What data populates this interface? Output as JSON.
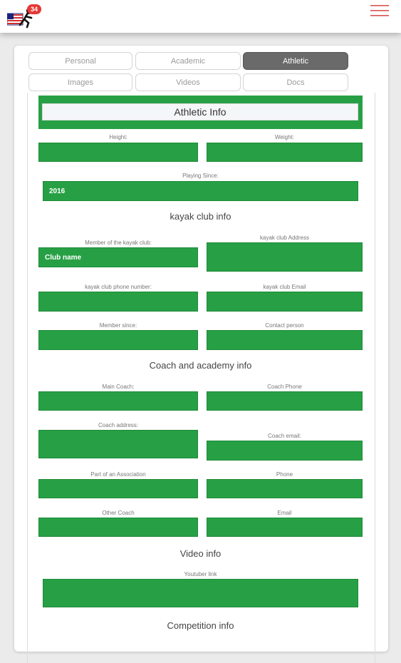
{
  "app": {
    "badge_count": "34",
    "accent_color": "#27a045",
    "logo_icon": "runner-flag-logo-icon",
    "menu_icon": "hamburger-menu-icon"
  },
  "tabs": [
    {
      "label": "Personal",
      "active": false
    },
    {
      "label": "Academic",
      "active": false
    },
    {
      "label": "Athletic",
      "active": true
    },
    {
      "label": "Images",
      "active": false
    },
    {
      "label": "Videos",
      "active": false
    },
    {
      "label": "Docs",
      "active": false
    }
  ],
  "form": {
    "title": "Athletic Info",
    "height": {
      "label": "Height:",
      "value": ""
    },
    "weight": {
      "label": "Weight:",
      "value": ""
    },
    "playing_since": {
      "label": "Playing Since:",
      "value": "2016"
    },
    "section_club": "kayak club info",
    "club_member": {
      "label": "Member of the kayak club:",
      "value": "Club name"
    },
    "club_address": {
      "label": "kayak club Address",
      "value": ""
    },
    "club_phone": {
      "label": "kayak club phone number:",
      "value": ""
    },
    "club_email": {
      "label": "kayak club Email",
      "value": ""
    },
    "member_since": {
      "label": "Member since:",
      "value": ""
    },
    "contact_person": {
      "label": "Contact person",
      "value": ""
    },
    "section_coach": "Coach and academy info",
    "main_coach": {
      "label": "Main Coach:",
      "value": ""
    },
    "coach_phone": {
      "label": "Coach Phone",
      "value": ""
    },
    "coach_address": {
      "label": "Coach address:",
      "value": ""
    },
    "coach_email": {
      "label": "Coach email:",
      "value": ""
    },
    "association": {
      "label": "Part of an Association",
      "value": ""
    },
    "phone": {
      "label": "Phone",
      "value": ""
    },
    "other_coach": {
      "label": "Other Coach",
      "value": ""
    },
    "email": {
      "label": "Email",
      "value": ""
    },
    "section_video": "Video info",
    "youtube_link": {
      "label": "Youtuber link",
      "value": ""
    },
    "section_competition": "Competition info"
  }
}
